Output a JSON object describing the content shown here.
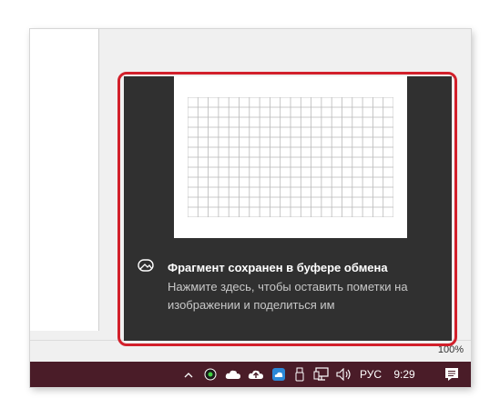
{
  "statusbar": {
    "zoom": "100%"
  },
  "toast": {
    "title": "Фрагмент сохранен в буфере обмена",
    "body": "Нажмите здесь, чтобы оставить пометки на изображении и поделиться им"
  },
  "taskbar": {
    "language": "РУС",
    "time": "9:29",
    "accent_color": "#4a1c28"
  },
  "highlight": {
    "color": "#d2202b"
  }
}
